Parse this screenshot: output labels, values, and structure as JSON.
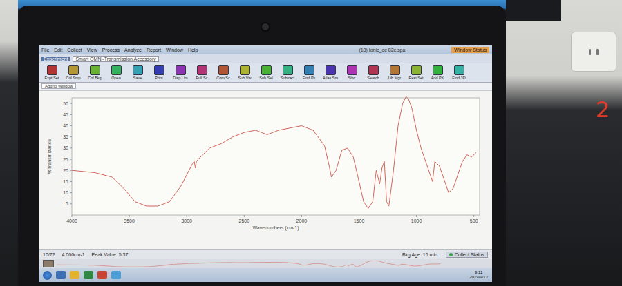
{
  "window": {
    "title": "(18) Ionic_oc 82c.spa",
    "status_box": "Window Status"
  },
  "menu": [
    "File",
    "Edit",
    "Collect",
    "View",
    "Process",
    "Analyze",
    "Report",
    "Window",
    "Help"
  ],
  "experiment": {
    "label": "Experiment",
    "value": "Smart OMNI-Transmission Accessory"
  },
  "toolbar": [
    "Expt Set",
    "Col Smp",
    "Col Bkg",
    "Open",
    "Save",
    "Print",
    "Disp Lim",
    "Full Sc",
    "Com Sc",
    "Sub Vw",
    "Sub Sel",
    "Subtract",
    "Find Pk",
    "Atlas Sm",
    "Sibc",
    "Search",
    "Lib Mgr",
    "Rest Set",
    "Add PK",
    "Find 3D"
  ],
  "window_list": "Add to Window",
  "chart": {
    "y_label": "%Transmittance",
    "x_label": "Wavenumbers (cm-1)",
    "y_ticks": [
      "50",
      "45",
      "40",
      "35",
      "30",
      "25",
      "20",
      "15",
      "10",
      "5"
    ],
    "x_ticks": [
      "4000",
      "3500",
      "3000",
      "2500",
      "2000",
      "1500",
      "1000",
      "500"
    ],
    "series": [
      {
        "name": "spectrum",
        "color": "#d0655a",
        "x": [
          4000,
          3800,
          3650,
          3550,
          3450,
          3350,
          3250,
          3150,
          3050,
          2980,
          2950,
          2935,
          2925,
          2915,
          2900,
          2860,
          2800,
          2700,
          2600,
          2500,
          2400,
          2350,
          2300,
          2200,
          2100,
          2000,
          1900,
          1800,
          1760,
          1740,
          1700,
          1650,
          1600,
          1550,
          1500,
          1460,
          1420,
          1380,
          1350,
          1320,
          1300,
          1280,
          1260,
          1240,
          1200,
          1160,
          1120,
          1090,
          1070,
          1040,
          1000,
          960,
          920,
          880,
          860,
          840,
          800,
          760,
          720,
          680,
          640,
          600,
          560,
          520,
          480
        ],
        "y": [
          20,
          19,
          17,
          12,
          6,
          4,
          4,
          6,
          13,
          20,
          23,
          24,
          21,
          24,
          25,
          27,
          30,
          32,
          35,
          37,
          38,
          37,
          36,
          38,
          39,
          40,
          38,
          31,
          22,
          17,
          20,
          29,
          30,
          26,
          15,
          6,
          3,
          6,
          20,
          14,
          21,
          24,
          6,
          4,
          20,
          40,
          50,
          53,
          52,
          48,
          38,
          30,
          24,
          18,
          15,
          24,
          22,
          16,
          10,
          12,
          18,
          24,
          27,
          26,
          28
        ]
      }
    ]
  },
  "status_bar": {
    "page": "10/72",
    "resolution": "4.000cm-1",
    "peak_value": "Peak Value: 5.37",
    "bkg_age": "Bkg Age: 15 min.",
    "collect_status": "Collect Status"
  },
  "taskbar": {
    "time": "9:11",
    "date": "2019/9/12"
  },
  "photo": {
    "marker": "2"
  }
}
